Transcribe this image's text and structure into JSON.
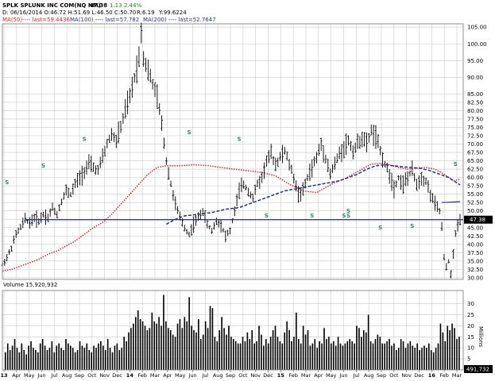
{
  "chart_data": {
    "type": "line",
    "header": {
      "title": "SPLK SPLUNK INC COM(NQ NM)",
      "last": "47.38",
      "change": "1.13",
      "change_pct": "2.44%",
      "date_line": "D: 06/16/2014  O:46.72  H:51.69  L:46.50  C:50.70",
      "r_label": "R:6.19",
      "y_label": "Y:99.6224",
      "ma_line_ma50": "MA(50)---- last=59.4436",
      "ma_line_ma100": "MA(100) ---- last=57.782",
      "ma_line_ma200": "MA(200) ---- last=52.7647"
    },
    "price_axis": {
      "ticks": [
        30.0,
        32.5,
        35.0,
        37.5,
        40.0,
        42.5,
        45.0,
        47.5,
        50.0,
        52.5,
        55.0,
        57.5,
        60.0,
        62.5,
        65.0,
        67.5,
        70.0,
        72.5,
        75.0,
        77.5,
        80.0,
        82.5,
        85.0,
        90.0,
        95.0,
        100.0,
        105.0
      ],
      "tick_labels": [
        "30.00",
        "32.50",
        "35.00",
        "37.50",
        "40.00",
        "42.50",
        "45.00",
        "47.50",
        "50.00",
        "52.50",
        "55.00",
        "57.50",
        "60.00",
        "62.50",
        "65.00",
        "67.50",
        "70.00",
        "72.50",
        "75.00",
        "77.50",
        "80.00",
        "82.50",
        "85.00",
        "90.00",
        "95.00",
        "100.00",
        "105.00"
      ],
      "last_price_label": "47.38",
      "reference_line": 47.38
    },
    "volume": {
      "title": "Volume 15,920,932",
      "axis_label": "Millions",
      "ticks": [
        5,
        10,
        15,
        20,
        25,
        30
      ],
      "last_label": "491,732",
      "values": [
        8,
        12,
        9,
        11,
        14,
        10,
        8,
        12,
        9,
        7,
        11,
        13,
        10,
        9,
        8,
        12,
        14,
        11,
        9,
        10,
        13,
        8,
        11,
        12,
        10,
        9,
        14,
        12,
        11,
        10,
        8,
        9,
        13,
        11,
        10,
        12,
        9,
        8,
        11,
        10,
        12,
        13,
        11,
        9,
        14,
        10,
        8,
        11,
        12,
        9,
        10,
        15,
        13,
        17,
        19,
        21,
        24,
        27,
        23,
        22,
        20,
        18,
        19,
        26,
        22,
        21,
        24,
        20,
        34,
        22,
        19,
        18,
        16,
        15,
        21,
        23,
        19,
        24,
        22,
        33,
        20,
        18,
        17,
        23,
        14,
        16,
        22,
        19,
        29,
        28,
        15,
        13,
        18,
        24,
        19,
        16,
        20,
        15,
        14,
        13,
        12,
        12,
        15,
        13,
        17,
        14,
        18,
        12,
        13,
        20,
        16,
        11,
        14,
        12,
        15,
        18,
        20,
        15,
        13,
        12,
        17,
        22,
        18,
        13,
        15,
        26,
        14,
        12,
        20,
        16,
        18,
        11,
        12,
        14,
        10,
        13,
        12,
        19,
        14,
        15,
        12,
        13,
        11,
        15,
        12,
        11,
        12,
        13,
        14,
        13,
        12,
        20,
        19,
        15,
        18,
        17,
        25,
        13,
        12,
        14,
        16,
        15,
        12,
        12,
        13,
        14,
        11,
        12,
        9,
        10,
        14,
        13,
        10,
        12,
        13,
        11,
        10,
        12,
        9,
        10,
        11,
        10,
        12,
        9,
        8,
        10,
        12,
        21,
        17,
        13,
        20,
        18,
        21,
        19,
        14,
        15
      ]
    },
    "x_axis": {
      "labels": [
        "13",
        "Apr",
        "May",
        "Jun",
        "Jul",
        "Aug",
        "Sep",
        "Oct",
        "Nov",
        "Dec",
        "14",
        "Feb",
        "Mar",
        "Apr",
        "May",
        "Jun",
        "Jul",
        "Aug",
        "Sep",
        "Oct",
        "Nov",
        "Dec",
        "15",
        "Feb",
        "Mar",
        "Apr",
        "May",
        "Jun",
        "Jul",
        "Aug",
        "Sep",
        "Oct",
        "Nov",
        "Dec",
        "16",
        "Feb",
        "Mar"
      ]
    },
    "price_path": [
      [
        0,
        34.0
      ],
      [
        2,
        36.0
      ],
      [
        4,
        39.0
      ],
      [
        6,
        43.0
      ],
      [
        8,
        45.0
      ],
      [
        10,
        47.5
      ],
      [
        12,
        46.5
      ],
      [
        14,
        48.0
      ],
      [
        16,
        47.0
      ],
      [
        18,
        49.0
      ],
      [
        20,
        48.0
      ],
      [
        22,
        51.0
      ],
      [
        24,
        49.0
      ],
      [
        26,
        53.0
      ],
      [
        28,
        56.0
      ],
      [
        30,
        55.0
      ],
      [
        32,
        58.0
      ],
      [
        34,
        60.0
      ],
      [
        36,
        62.0
      ],
      [
        38,
        64.0
      ],
      [
        40,
        63.0
      ],
      [
        42,
        62.0
      ],
      [
        44,
        66.0
      ],
      [
        46,
        70.0
      ],
      [
        48,
        73.0
      ],
      [
        50,
        71.0
      ],
      [
        52,
        75.0
      ],
      [
        54,
        80.0
      ],
      [
        56,
        84.0
      ],
      [
        58,
        90.0
      ],
      [
        60,
        96.0
      ],
      [
        61,
        104.0
      ],
      [
        62,
        96.0
      ],
      [
        64,
        92.0
      ],
      [
        66,
        88.0
      ],
      [
        68,
        84.0
      ],
      [
        70,
        76.0
      ],
      [
        72,
        65.0
      ],
      [
        74,
        58.0
      ],
      [
        76,
        52.0
      ],
      [
        78,
        48.0
      ],
      [
        80,
        45.0
      ],
      [
        82,
        43.0
      ],
      [
        84,
        46.0
      ],
      [
        86,
        48.0
      ],
      [
        88,
        50.0
      ],
      [
        90,
        46.0
      ],
      [
        92,
        44.0
      ],
      [
        94,
        47.0
      ],
      [
        96,
        46.0
      ],
      [
        98,
        42.5
      ],
      [
        100,
        44.0
      ],
      [
        102,
        50.0
      ],
      [
        104,
        56.0
      ],
      [
        106,
        58.0
      ],
      [
        108,
        56.0
      ],
      [
        110,
        54.0
      ],
      [
        112,
        58.0
      ],
      [
        114,
        60.0
      ],
      [
        116,
        65.0
      ],
      [
        118,
        67.0
      ],
      [
        120,
        64.0
      ],
      [
        122,
        66.0
      ],
      [
        124,
        68.0
      ],
      [
        126,
        64.0
      ],
      [
        128,
        60.0
      ],
      [
        130,
        55.0
      ],
      [
        132,
        56.0
      ],
      [
        134,
        60.0
      ],
      [
        136,
        63.0
      ],
      [
        138,
        66.0
      ],
      [
        140,
        70.0
      ],
      [
        142,
        66.0
      ],
      [
        144,
        61.0
      ],
      [
        146,
        64.0
      ],
      [
        148,
        67.0
      ],
      [
        150,
        69.0
      ],
      [
        152,
        71.0
      ],
      [
        154,
        68.0
      ],
      [
        156,
        70.0
      ],
      [
        158,
        72.0
      ],
      [
        160,
        70.0
      ],
      [
        162,
        74.0
      ],
      [
        164,
        72.0
      ],
      [
        166,
        68.0
      ],
      [
        168,
        64.0
      ],
      [
        170,
        61.0
      ],
      [
        172,
        57.0
      ],
      [
        174,
        60.0
      ],
      [
        176,
        58.0
      ],
      [
        178,
        60.0
      ],
      [
        180,
        62.0
      ],
      [
        182,
        58.0
      ],
      [
        184,
        60.0
      ],
      [
        186,
        59.0
      ],
      [
        188,
        55.0
      ],
      [
        190,
        52.0
      ],
      [
        192,
        50.0
      ],
      [
        193,
        45.0
      ],
      [
        194,
        36.0
      ],
      [
        195,
        33.0
      ],
      [
        196,
        35.0
      ],
      [
        197,
        31.0
      ],
      [
        198,
        37.0
      ],
      [
        199,
        43.0
      ],
      [
        200,
        46.0
      ],
      [
        201,
        47.4
      ]
    ],
    "series": [
      {
        "name": "MA(50)",
        "color": "#d9262b",
        "style": "dotted",
        "points": [
          [
            0,
            32.0
          ],
          [
            4,
            32.5
          ],
          [
            8,
            33.5
          ],
          [
            12,
            34.5
          ],
          [
            16,
            35.5
          ],
          [
            20,
            37.0
          ],
          [
            24,
            38.0
          ],
          [
            28,
            39.5
          ],
          [
            32,
            41.0
          ],
          [
            36,
            43.0
          ],
          [
            40,
            45.0
          ],
          [
            44,
            46.5
          ],
          [
            48,
            49.0
          ],
          [
            52,
            52.0
          ],
          [
            56,
            55.0
          ],
          [
            60,
            58.0
          ],
          [
            64,
            61.0
          ],
          [
            68,
            63.0
          ],
          [
            72,
            63.5
          ],
          [
            78,
            63.5
          ],
          [
            84,
            63.8
          ],
          [
            90,
            63.6
          ],
          [
            96,
            63.0
          ],
          [
            102,
            62.5
          ],
          [
            108,
            62.0
          ],
          [
            114,
            61.5
          ],
          [
            120,
            60.5
          ],
          [
            126,
            58.0
          ],
          [
            132,
            56.0
          ],
          [
            138,
            55.5
          ],
          [
            142,
            57.0
          ],
          [
            146,
            58.5
          ],
          [
            150,
            59.5
          ],
          [
            154,
            61.0
          ],
          [
            158,
            62.5
          ],
          [
            162,
            64.0
          ],
          [
            166,
            64.2
          ],
          [
            170,
            63.8
          ],
          [
            174,
            63.0
          ],
          [
            178,
            62.5
          ],
          [
            182,
            62.8
          ],
          [
            186,
            63.0
          ],
          [
            190,
            62.5
          ],
          [
            194,
            61.0
          ],
          [
            198,
            59.0
          ],
          [
            201,
            59.44
          ]
        ]
      },
      {
        "name": "MA(100)",
        "color": "#20308a",
        "style": "dashed",
        "points": [
          [
            72,
            46.0
          ],
          [
            76,
            47.5
          ],
          [
            80,
            48.5
          ],
          [
            86,
            49.0
          ],
          [
            92,
            49.5
          ],
          [
            98,
            50.5
          ],
          [
            104,
            51.0
          ],
          [
            108,
            52.0
          ],
          [
            112,
            53.0
          ],
          [
            116,
            54.0
          ],
          [
            120,
            55.0
          ],
          [
            124,
            56.0
          ],
          [
            128,
            56.5
          ],
          [
            132,
            57.0
          ],
          [
            136,
            57.5
          ],
          [
            140,
            58.0
          ],
          [
            144,
            58.5
          ],
          [
            148,
            59.0
          ],
          [
            152,
            60.0
          ],
          [
            156,
            61.0
          ],
          [
            160,
            62.5
          ],
          [
            164,
            63.5
          ],
          [
            168,
            63.8
          ],
          [
            172,
            63.5
          ],
          [
            176,
            63.2
          ],
          [
            180,
            63.0
          ],
          [
            184,
            62.7
          ],
          [
            188,
            62.0
          ],
          [
            192,
            61.0
          ],
          [
            196,
            60.0
          ],
          [
            201,
            57.78
          ]
        ]
      },
      {
        "name": "MA(200)",
        "color": "#20308a",
        "style": "solid",
        "points": [
          [
            193,
            52.5
          ],
          [
            201,
            52.76
          ]
        ]
      }
    ],
    "s_markers": [
      [
        2,
        58.0
      ],
      [
        18,
        63.0
      ],
      [
        36,
        71.0
      ],
      [
        82,
        73.0
      ],
      [
        104,
        71.0
      ],
      [
        116,
        48.0
      ],
      [
        136,
        48.0
      ],
      [
        150,
        48.0
      ],
      [
        152,
        49.5
      ],
      [
        152,
        48.0
      ],
      [
        166,
        44.5
      ],
      [
        180,
        45.0
      ],
      [
        199,
        63.5
      ]
    ],
    "ylim": [
      29.5,
      106.0
    ]
  }
}
